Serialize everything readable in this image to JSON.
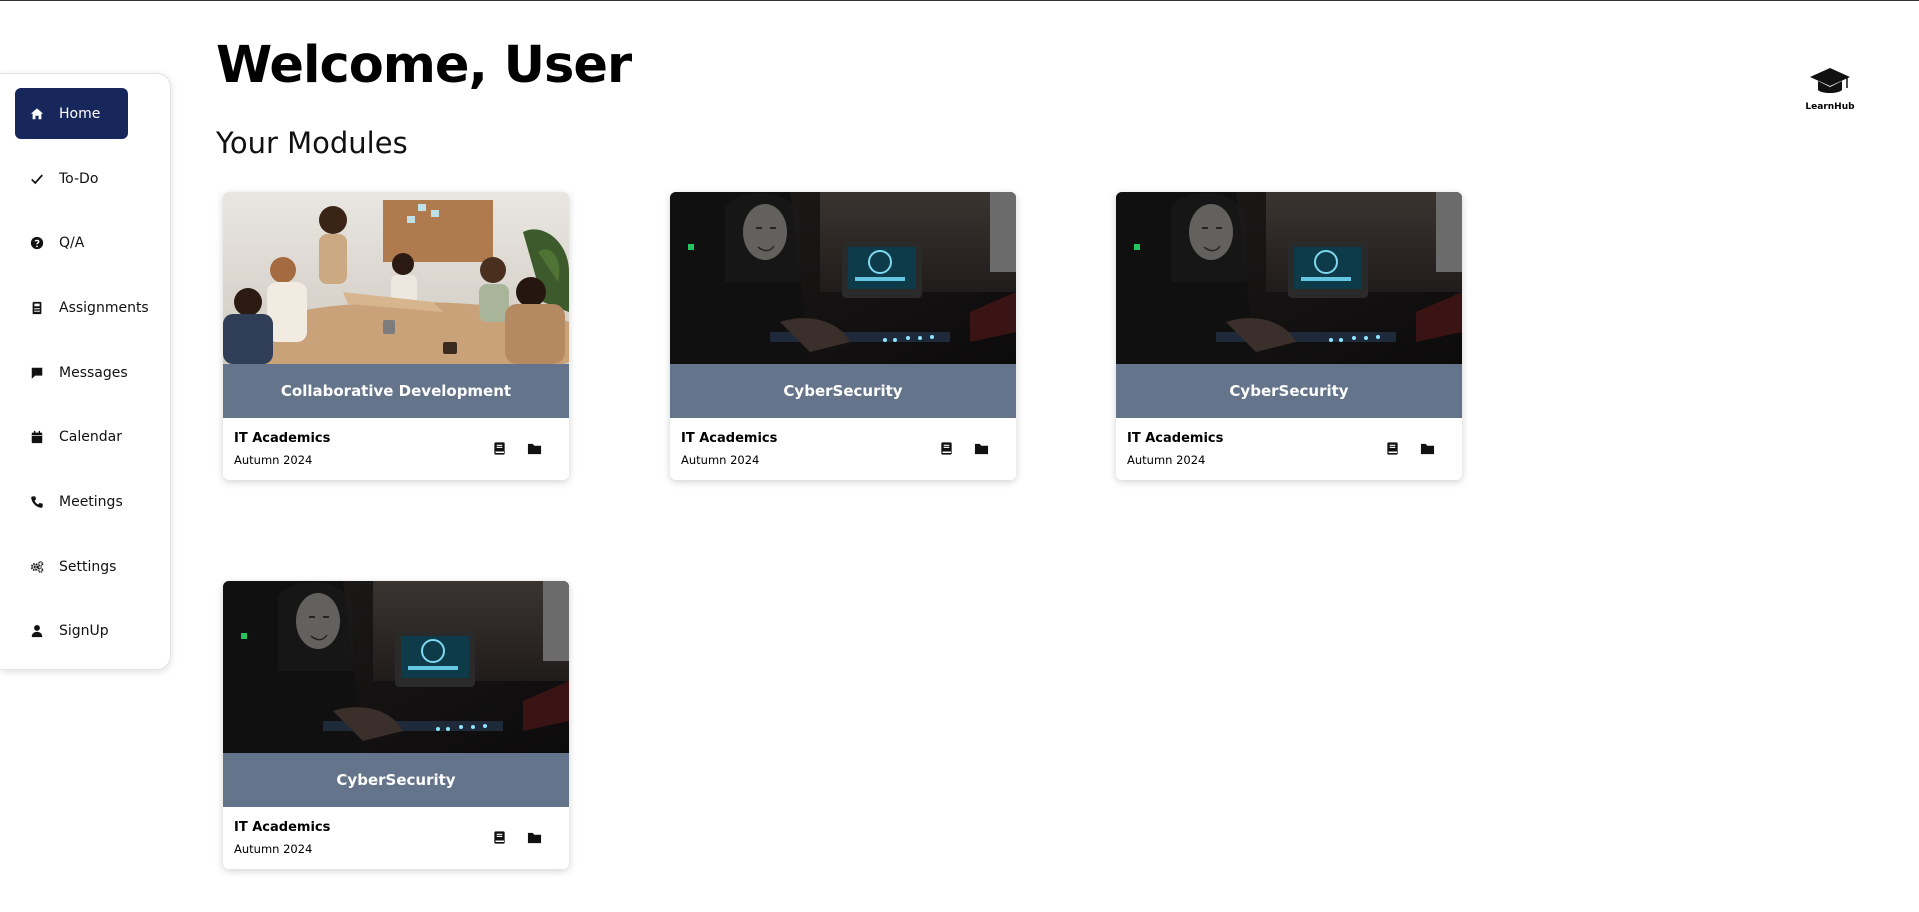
{
  "header": {
    "welcome": "Welcome, User",
    "section_title": "Your Modules"
  },
  "logo": {
    "icon": "graduation-cap-icon",
    "text": "LearnHub"
  },
  "sidebar": {
    "active_color": "#17275c",
    "items": [
      {
        "label": "Home",
        "icon": "home-icon",
        "active": true
      },
      {
        "label": "To-Do",
        "icon": "check-icon",
        "active": false
      },
      {
        "label": "Q/A",
        "icon": "question-circle-icon",
        "active": false
      },
      {
        "label": "Assignments",
        "icon": "calculator-icon",
        "active": false
      },
      {
        "label": "Messages",
        "icon": "message-icon",
        "active": false
      },
      {
        "label": "Calendar",
        "icon": "calendar-icon",
        "active": false
      },
      {
        "label": "Meetings",
        "icon": "phone-icon",
        "active": false
      },
      {
        "label": "Settings",
        "icon": "gears-icon",
        "active": false
      },
      {
        "label": "SignUp",
        "icon": "user-icon",
        "active": false
      }
    ]
  },
  "modules": {
    "band_color": "#64748b",
    "cards": [
      {
        "title": "Collaborative Development",
        "provider": "IT Academics",
        "term": "Autumn 2024",
        "image": "team-meeting-photo"
      },
      {
        "title": "CyberSecurity",
        "provider": "IT Academics",
        "term": "Autumn 2024",
        "image": "hacker-photo"
      },
      {
        "title": "CyberSecurity",
        "provider": "IT Academics",
        "term": "Autumn 2024",
        "image": "hacker-photo"
      },
      {
        "title": "CyberSecurity",
        "provider": "IT Academics",
        "term": "Autumn 2024",
        "image": "hacker-photo"
      }
    ],
    "actions": [
      {
        "icon": "book-icon"
      },
      {
        "icon": "folder-icon"
      }
    ]
  }
}
